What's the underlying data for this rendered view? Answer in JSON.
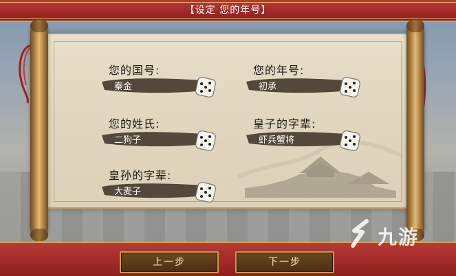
{
  "header": {
    "title": "【设定 您的年号】"
  },
  "fields": {
    "guohao": {
      "label": "您的国号:",
      "value": "秦金"
    },
    "nianhao": {
      "label": "您的年号:",
      "value": "初承"
    },
    "xingshi": {
      "label": "您的姓氏:",
      "value": "二狗子"
    },
    "huangzi": {
      "label": "皇子的字辈:",
      "value": "虾兵蟹将"
    },
    "huangsun": {
      "label": "皇孙的字辈:",
      "value": "大麦子"
    }
  },
  "buttons": {
    "prev": "上一步",
    "next": "下一步"
  },
  "watermark": {
    "text": "九游"
  },
  "colors": {
    "bar_red": "#a52a27",
    "gold": "#d3a35d",
    "paper": "#e4dac3"
  }
}
